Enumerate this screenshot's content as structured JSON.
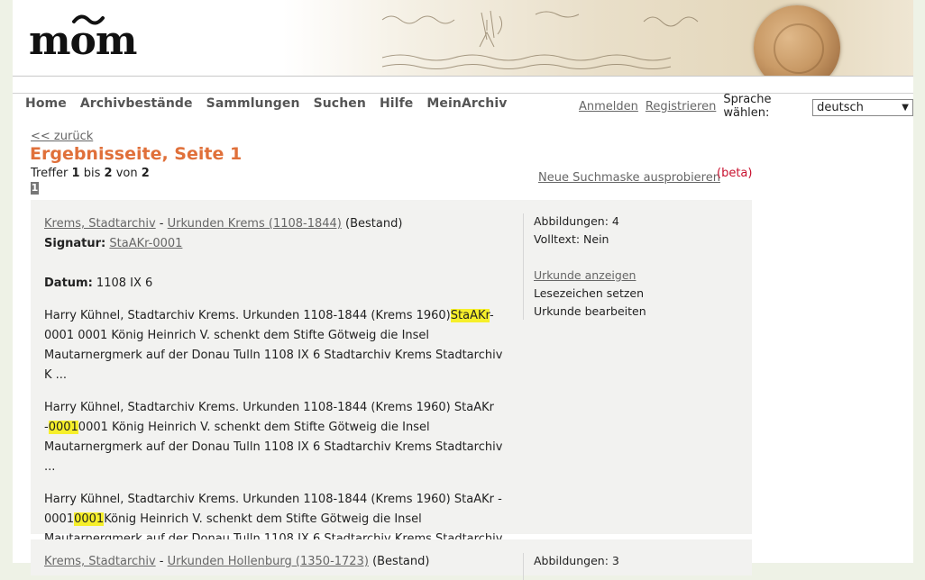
{
  "header": {
    "logo_text": "mom",
    "nav": [
      "Home",
      "Archivbestände",
      "Sammlungen",
      "Suchen",
      "Hilfe",
      "MeinArchiv"
    ],
    "login": "Anmelden",
    "register": "Registrieren",
    "language_label": "Sprache wählen:",
    "language_value": "deutsch"
  },
  "results": {
    "back": "<< zurück",
    "title": "Ergebnisseite, Seite 1",
    "hits_prefix": "Treffer",
    "hits_from": "1",
    "hits_to_label": "bis",
    "hits_to": "2",
    "hits_of_label": "von",
    "hits_total": "2",
    "current_page": "1",
    "new_mask": "Neue Suchmaske ausprobieren",
    "beta": "(beta)"
  },
  "cards": [
    {
      "archive": "Krems, Stadtarchiv",
      "dash": " - ",
      "fond": "Urkunden Krems (1108-1844)",
      "fond_type": "(Bestand)",
      "signature_label": "Signatur:",
      "signature": "StaAKr-0001",
      "date_label": "Datum:",
      "date": "1108 IX 6",
      "snippets": [
        {
          "pre": "Harry Kühnel, Stadtarchiv Krems. Urkunden 1108-1844 (Krems 1960)",
          "hl": "StaAKr",
          "post": "- 0001 0001 König Heinrich V. schenkt dem Stifte Götweig die Insel Mautarnergmerk auf der Donau Tulln 1108 IX 6 Stadtarchiv Krems Stadtarchiv K ..."
        },
        {
          "pre": "Harry Kühnel, Stadtarchiv Krems. Urkunden 1108-1844 (Krems 1960) StaAKr -",
          "hl": "0001",
          "post": "0001 König Heinrich V. schenkt dem Stifte Götweig die Insel Mautarnergmerk auf der Donau Tulln 1108 IX 6 Stadtarchiv Krems Stadtarchiv ..."
        },
        {
          "pre": "Harry Kühnel, Stadtarchiv Krems. Urkunden 1108-1844 (Krems 1960) StaAKr - 0001",
          "hl": "0001",
          "post": "König Heinrich V. schenkt dem Stifte Götweig die Insel Mautarnergmerk auf der Donau Tulln 1108 IX 6 Stadtarchiv Krems Stadtarchiv ..."
        }
      ],
      "images": "Abbildungen: 4",
      "fulltext": "Volltext: Nein",
      "show": "Urkunde anzeigen",
      "bookmark": "Lesezeichen setzen",
      "edit": "Urkunde bearbeiten"
    },
    {
      "archive": "Krems, Stadtarchiv",
      "dash": " - ",
      "fond": "Urkunden Hollenburg (1350-1723)",
      "fond_type": "(Bestand)",
      "images": "Abbildungen: 3"
    }
  ]
}
